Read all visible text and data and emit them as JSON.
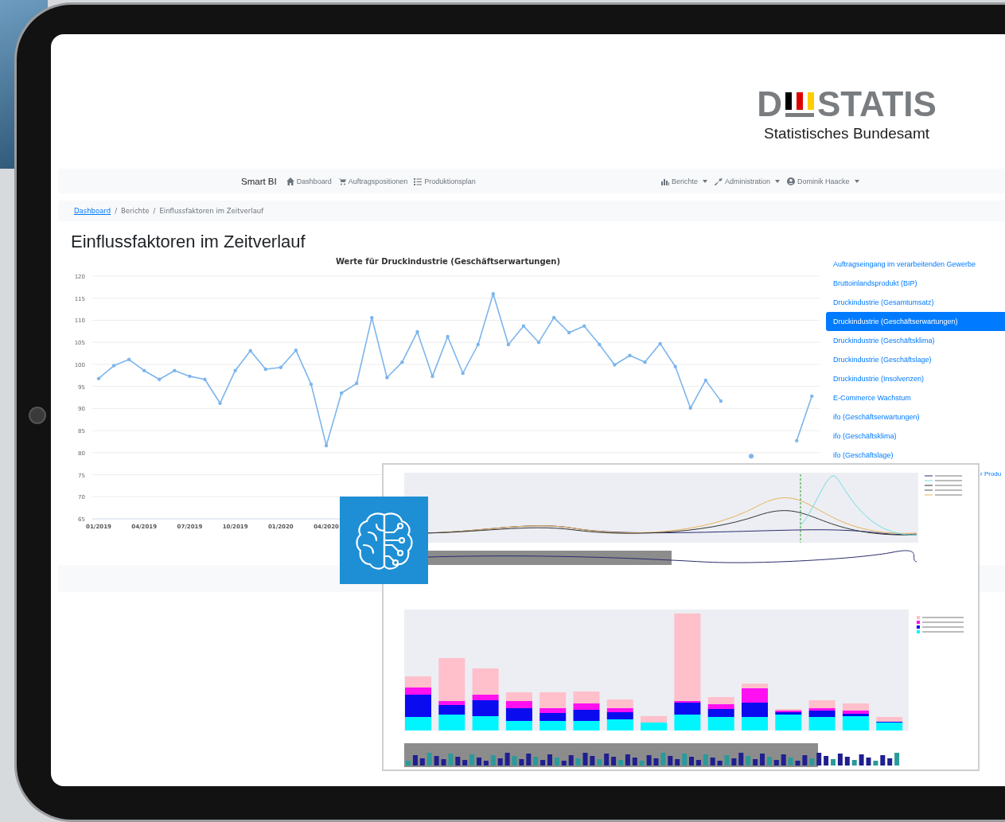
{
  "logo": {
    "mark_left": "D",
    "mark_right": "STATIS",
    "subtitle": "Statistisches Bundesamt"
  },
  "navbar": {
    "brand": "Smart BI",
    "left_items": [
      {
        "label": "Dashboard"
      },
      {
        "label": "Auftragspositionen"
      },
      {
        "label": "Produktionsplan"
      }
    ],
    "right_items": [
      {
        "label": "Berichte",
        "dropdown": true
      },
      {
        "label": "Administration",
        "dropdown": true
      },
      {
        "label": "Dominik Haacke",
        "dropdown": true
      }
    ]
  },
  "breadcrumb": {
    "items": [
      {
        "label": "Dashboard",
        "link": true
      },
      {
        "label": "Berichte",
        "link": false
      },
      {
        "label": "Einflussfaktoren im Zeitverlauf",
        "link": false
      }
    ],
    "separators": [
      "/",
      "/"
    ]
  },
  "page_title": "Einflussfaktoren im Zeitverlauf",
  "chart": {
    "chart_data": {
      "type": "line",
      "title": "Werte für Druckindustrie (Geschäftserwartungen)",
      "categories": [
        "01/2019",
        null,
        null,
        "04/2019",
        null,
        null,
        "07/2019",
        null,
        null,
        "10/2019",
        null,
        null,
        "01/2020",
        null,
        null,
        "04/2020",
        null,
        null,
        null,
        null,
        null,
        null,
        null,
        null,
        null,
        null,
        null,
        null,
        null,
        null,
        null,
        null,
        null,
        null,
        null,
        null,
        null,
        null,
        null,
        null,
        null,
        null,
        null,
        null,
        null,
        null,
        null,
        null
      ],
      "grid": true,
      "series": [
        {
          "color": "#7cb5ec",
          "values": [
            96.8,
            99.7,
            101.1,
            98.6,
            96.6,
            98.6,
            97.3,
            96.6,
            91.2,
            98.6,
            103.1,
            98.9,
            99.3,
            103.2,
            95.5,
            81.6,
            93.5,
            95.7,
            110.6,
            97,
            100.5,
            107.4,
            97.3,
            106.3,
            98,
            104.5,
            116,
            104.5,
            108.7,
            105,
            110.6,
            107.2,
            108.7,
            104.5,
            99.9,
            102,
            100.5,
            104.7,
            99.5,
            90.1,
            96.4,
            91.7,
            null,
            79.2,
            null,
            null,
            82.7,
            92.8
          ]
        }
      ],
      "ylim": [
        65,
        120
      ],
      "yticks": [
        65,
        70,
        75,
        80,
        85,
        90,
        95,
        100,
        105,
        110,
        115,
        120
      ]
    }
  },
  "report_list": [
    {
      "label": "Auftragseingang im verarbeitenden Gewerbe",
      "selected": false,
      "kind": "link"
    },
    {
      "label": "Bruttoinlandsprodukt (BIP)",
      "selected": false,
      "kind": "link"
    },
    {
      "label": "Druckindustrie (Gesamtumsatz)",
      "selected": false,
      "kind": "link"
    },
    {
      "label": "Druckindustrie (Geschäftserwartungen)",
      "selected": true,
      "kind": "link"
    },
    {
      "label": "Druckindustrie (Geschäftsklima)",
      "selected": false,
      "kind": "link"
    },
    {
      "label": "Druckindustrie (Geschäftslage)",
      "selected": false,
      "kind": "link"
    },
    {
      "label": "Druckindustrie (Insolvenzen)",
      "selected": false,
      "kind": "link"
    },
    {
      "label": "E-Commerce Wachstum",
      "selected": false,
      "kind": "link"
    },
    {
      "label": "ifo (Geschäftserwartungen)",
      "selected": false,
      "kind": "link"
    },
    {
      "label": "ifo (Geschäftsklima)",
      "selected": false,
      "kind": "link"
    },
    {
      "label": "ifo (Geschäftslage)",
      "selected": false,
      "kind": "link"
    },
    {
      "label": "r Produ",
      "selected": false,
      "kind": "cut"
    }
  ]
}
